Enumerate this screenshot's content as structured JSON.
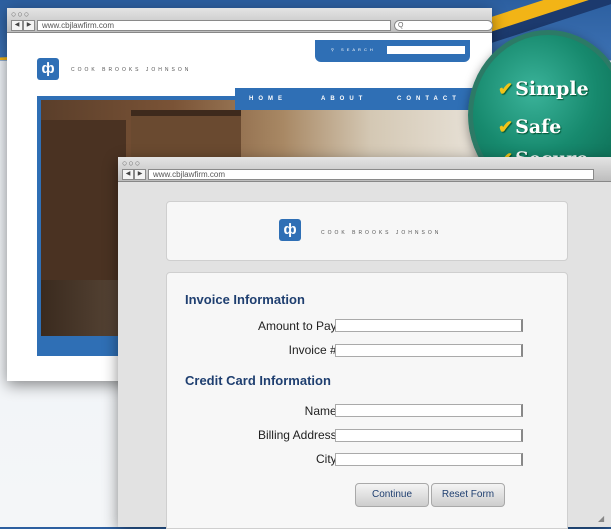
{
  "colors": {
    "accent": "#2f6fb5",
    "badge": "#178a6e",
    "title_text": "#1f3f70",
    "check": "#f0c419"
  },
  "back_window": {
    "url": "www.cbjlawfirm.com",
    "search_field_icon": "Q",
    "site_search_label": "SEARCH",
    "brand_name": "COOK BROOKS JOHNSON",
    "logo_glyph": "ф",
    "nav": [
      "HOME",
      "ABOUT",
      "CONTACT"
    ]
  },
  "badge": {
    "lines": [
      {
        "check": "✔",
        "text": "Simple"
      },
      {
        "check": "✔",
        "text": "Safe"
      },
      {
        "check": "✔",
        "text": "Secure"
      }
    ]
  },
  "front_window": {
    "url": "www.cbjlawfirm.com",
    "brand_name": "COOK BROOKS JOHNSON",
    "logo_glyph": "ф",
    "sections": {
      "invoice": {
        "title": "Invoice Information",
        "fields": [
          {
            "label": "Amount to Pay:",
            "value": ""
          },
          {
            "label": "Invoice #:",
            "value": ""
          }
        ]
      },
      "credit": {
        "title": "Credit Card Information",
        "fields": [
          {
            "label": "Name:",
            "value": ""
          },
          {
            "label": "Billing Address:",
            "value": ""
          },
          {
            "label": "City:",
            "value": ""
          }
        ]
      }
    },
    "buttons": {
      "continue": "Continue",
      "reset": "Reset Form"
    }
  }
}
